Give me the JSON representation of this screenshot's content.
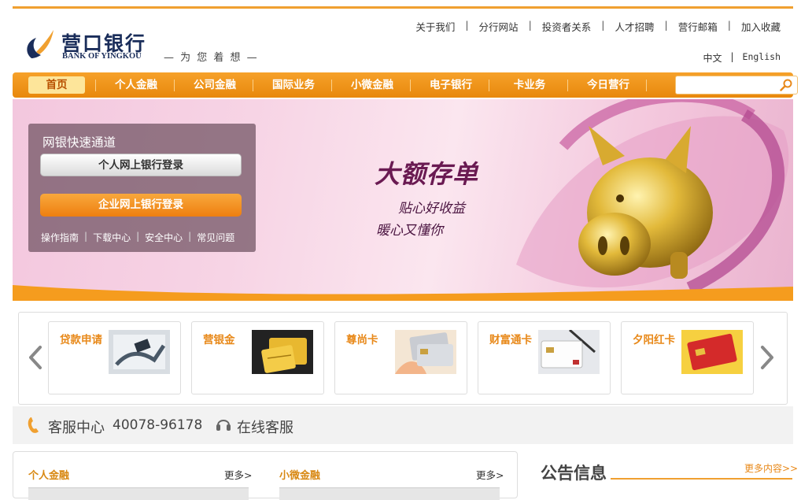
{
  "brand": {
    "name_cn": "营口银行",
    "name_en": "BANK OF YINGKOU",
    "slogan": "— 为 您 着 想 —"
  },
  "top_links": [
    "关于我们",
    "分行网站",
    "投资者关系",
    "人才招聘",
    "营行邮箱",
    "加入收藏"
  ],
  "languages": [
    "中文",
    "English"
  ],
  "nav": {
    "items": [
      "首页",
      "个人金融",
      "公司金融",
      "国际业务",
      "小微金融",
      "电子银行",
      "卡业务",
      "今日营行"
    ],
    "active": "首页",
    "search_placeholder": ""
  },
  "banner": {
    "login_title": "网银快速通道",
    "personal_login": "个人网上银行登录",
    "corporate_login": "企业网上银行登录",
    "links": [
      "操作指南",
      "下载中心",
      "安全中心",
      "常见问题"
    ],
    "headline": "大额存单",
    "line1": "贴心好收益",
    "line2": "暖心又懂你"
  },
  "products": [
    "贷款申请",
    "营银金",
    "尊尚卡",
    "财富通卡",
    "夕阳红卡"
  ],
  "service": {
    "label": "客服中心",
    "phone": "40078-96178",
    "online": "在线客服"
  },
  "columns": [
    {
      "title": "个人金融",
      "more": "更多>"
    },
    {
      "title": "小微金融",
      "more": "更多>"
    }
  ],
  "notice": {
    "title": "公告信息",
    "more": "更多内容>>"
  },
  "colors": {
    "accent": "#f0a030",
    "nav_bg": "#ee8f14",
    "brand_navy": "#1a2d5a",
    "banner_pink": "#f7d4e5"
  }
}
